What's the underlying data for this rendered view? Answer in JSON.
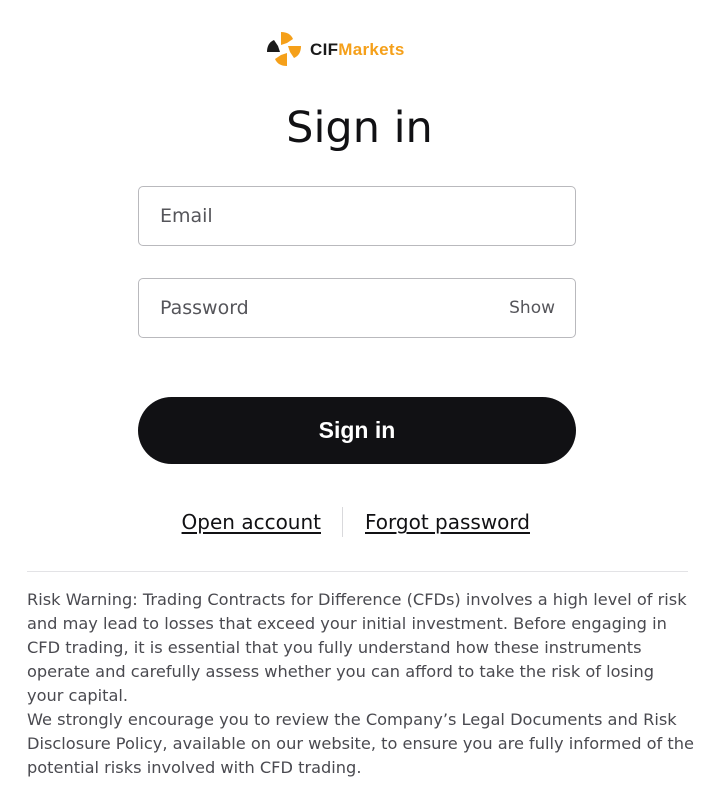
{
  "brand": {
    "name_part1": "CIF",
    "name_part2": "Markets",
    "icon": "pinwheel-logo-icon",
    "colors": {
      "accent": "#f5a01a",
      "dark": "#1a1a1a"
    }
  },
  "page": {
    "title": "Sign in"
  },
  "form": {
    "email_placeholder": "Email",
    "password_placeholder": "Password",
    "show_label": "Show",
    "submit_label": "Sign in",
    "submit_color": "#111114"
  },
  "links": {
    "open_account": "Open account",
    "forgot_password": "Forgot password"
  },
  "disclaimer": {
    "paragraph1": "Risk Warning: Trading Contracts for Difference (CFDs) involves a high level of risk and may lead to losses that exceed your initial investment. Before engaging in CFD trading, it is essential that you fully understand how these instruments operate and carefully assess whether you can afford to take the risk of losing your capital.",
    "paragraph2": "We strongly encourage you to review the Company’s Legal Documents and Risk Disclosure Policy, available on our website, to ensure you are fully informed of the potential risks involved with CFD trading."
  }
}
